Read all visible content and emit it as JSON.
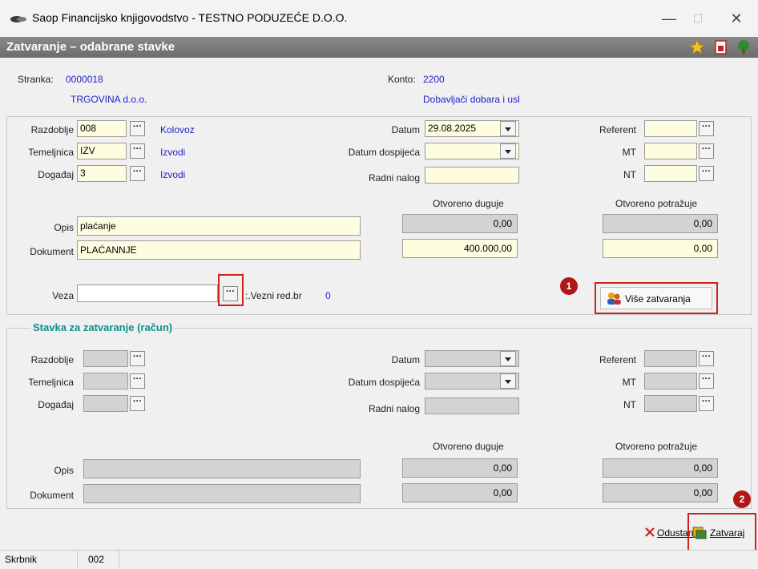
{
  "window": {
    "title": "Saop Financijsko knjigovodstvo - TESTNO PODUZEĆE D.O.O.",
    "minimize_glyph": "—",
    "maximize_glyph": "☐",
    "close_glyph": "✕"
  },
  "form_title": "Zatvaranje – odabrane stavke",
  "toolbar_icons": [
    "star-icon",
    "document-icon",
    "tree-icon"
  ],
  "header": {
    "stranka_label": "Stranka:",
    "stranka_code": "0000018",
    "stranka_name": "TRGOVINA d.o.o.",
    "konto_label": "Konto:",
    "konto_code": "2200",
    "konto_name": "Dobavljači dobara i usl"
  },
  "top": {
    "razdoblje_label": "Razdoblje",
    "razdoblje_value": "008",
    "razdoblje_text": "Kolovoz",
    "temeljnica_label": "Temeljnica",
    "temeljnica_value": "IZV",
    "temeljnica_text": "Izvodi",
    "dogadaj_label": "Događaj",
    "dogadaj_value": "3",
    "dogadaj_text": "Izvodi",
    "datum_label": "Datum",
    "datum_value": "29.08.2025",
    "dospijeca_label": "Datum dospijeća",
    "dospijeca_value": "",
    "nalog_label": "Radni nalog",
    "nalog_value": "",
    "referent_label": "Referent",
    "mt_label": "MT",
    "nt_label": "NT",
    "otv_duguje_label": "Otvoreno duguje",
    "otv_duguje_value": "0,00",
    "otv_potrazuje_label": "Otvoreno potražuje",
    "otv_potrazuje_value": "0,00",
    "duguje_input": "400.000,00",
    "potrazuje_input": "0,00",
    "opis_label": "Opis",
    "opis_value": "plaćanje",
    "dokument_label": "Dokument",
    "dokument_value": "PLAĆANNJE",
    "veza_label": "Veza",
    "veza_value": "",
    "vezni_label": ":.Vezni red.br",
    "vezni_value": "0",
    "vise_button": "Više zatvaranja",
    "badge1": "1"
  },
  "bottom": {
    "group_title": "Stavka za zatvaranje (račun)",
    "razdoblje_label": "Razdoblje",
    "temeljnica_label": "Temeljnica",
    "dogadaj_label": "Događaj",
    "datum_label": "Datum",
    "dospijeca_label": "Datum dospijeća",
    "nalog_label": "Radni nalog",
    "referent_label": "Referent",
    "mt_label": "MT",
    "nt_label": "NT",
    "otv_duguje_label": "Otvoreno duguje",
    "otv_potrazuje_label": "Otvoreno potražuje",
    "opis_label": "Opis",
    "dokument_label": "Dokument",
    "val1": "0,00",
    "val2": "0,00",
    "val3": "0,00",
    "val4": "0,00"
  },
  "actions": {
    "odustani": "Odustani",
    "zatvaraj": "Zatvaraj",
    "badge2": "2"
  },
  "status": {
    "label": "Skrbnik",
    "value": "002"
  },
  "ellipsis": "···"
}
